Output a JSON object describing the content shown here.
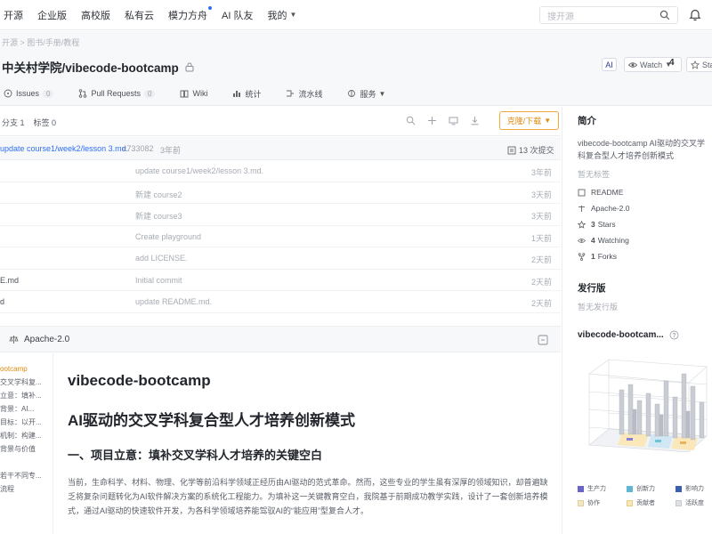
{
  "nav": {
    "items": [
      "开源",
      "企业版",
      "高校版",
      "私有云",
      "模力方舟",
      "AI 队友",
      "我的"
    ],
    "search_placeholder": "搜开源"
  },
  "repo": {
    "breadcrumb": "开源 > 图书/手册/教程",
    "title": "中关村学院/vibecode-bootcamp",
    "ai_badge": "AI",
    "watch_label": "Watch",
    "watch_count": "4",
    "star_label": "Star"
  },
  "tabs": [
    {
      "label": "Issues",
      "count": "0"
    },
    {
      "label": "Pull Requests",
      "count": "0"
    },
    {
      "label": "Wiki",
      "count": ""
    },
    {
      "label": "统计",
      "count": ""
    },
    {
      "label": "流水线",
      "count": ""
    },
    {
      "label": "服务",
      "count": ""
    }
  ],
  "toolbar": {
    "branches": "分支 1",
    "tags": "标签 0",
    "clone_label": "克隆/下载"
  },
  "commit": {
    "message": "update course1/week2/lesson 3.md.",
    "hash": "c733082",
    "time": "3年前",
    "count": "13 次提交"
  },
  "files": [
    {
      "name": "",
      "message": "update course1/week2/lesson 3.md.",
      "time": "3年前"
    },
    {
      "name": "",
      "message": "新建 course2",
      "time": "3天前"
    },
    {
      "name": "",
      "message": "新建 course3",
      "time": "3天前"
    },
    {
      "name": "",
      "message": "Create playground",
      "time": "1天前"
    },
    {
      "name": "",
      "message": "add LICENSE.",
      "time": "2天前"
    },
    {
      "name": "E.md",
      "message": "Initial commit",
      "time": "2天前"
    },
    {
      "name": "d",
      "message": "update README.md.",
      "time": "2天前"
    }
  ],
  "readme": {
    "license_label": "Apache-2.0",
    "toc": [
      "ootcamp",
      "交叉学科复...",
      "立意：填补...",
      "背景：AI...",
      "目标：以开...",
      "机制：构建...",
      "背景与价值",
      "",
      "若干不同专...",
      "流程"
    ],
    "h1": "vibecode-bootcamp",
    "h2": "AI驱动的交叉学科复合型人才培养创新模式",
    "h3": "一、项目立意：填补交叉学科人才培养的关键空白",
    "paragraph": "当前，生命科学、材料、物理、化学等前沿科学领域正经历由AI驱动的范式革命。然而，这些专业的学生虽有深厚的领域知识，却普遍缺乏将复杂问题转化为AI软件解决方案的系统化工程能力。为填补这一关键教育空白，我院基于前期成功教学实践，设计了一套创新培养模式，通过AI驱动的快速软件开发，为各科学领域培养能驾驭AI的“能应用”型复合人才。"
  },
  "sidebar": {
    "intro_title": "简介",
    "description": "vibecode-bootcamp AI驱动的交叉学科复合型人才培养创新模式",
    "no_tags": "暂无标签",
    "readme_label": "README",
    "license_label": "Apache-2.0",
    "stars_count": "3",
    "stars_label": "Stars",
    "watching_count": "4",
    "watching_label": "Watching",
    "forks_count": "1",
    "forks_label": "Forks",
    "release_title": "发行版",
    "no_release": "暂无发行版",
    "chart_title": "vibecode-bootcam...",
    "legend": [
      "生产力",
      "创新力",
      "影响力",
      "协作",
      "贡献者",
      "活跃度"
    ]
  },
  "colors": {
    "accent": "#2f6ff5",
    "clone": "#e08a10",
    "border": "#eceef1"
  }
}
